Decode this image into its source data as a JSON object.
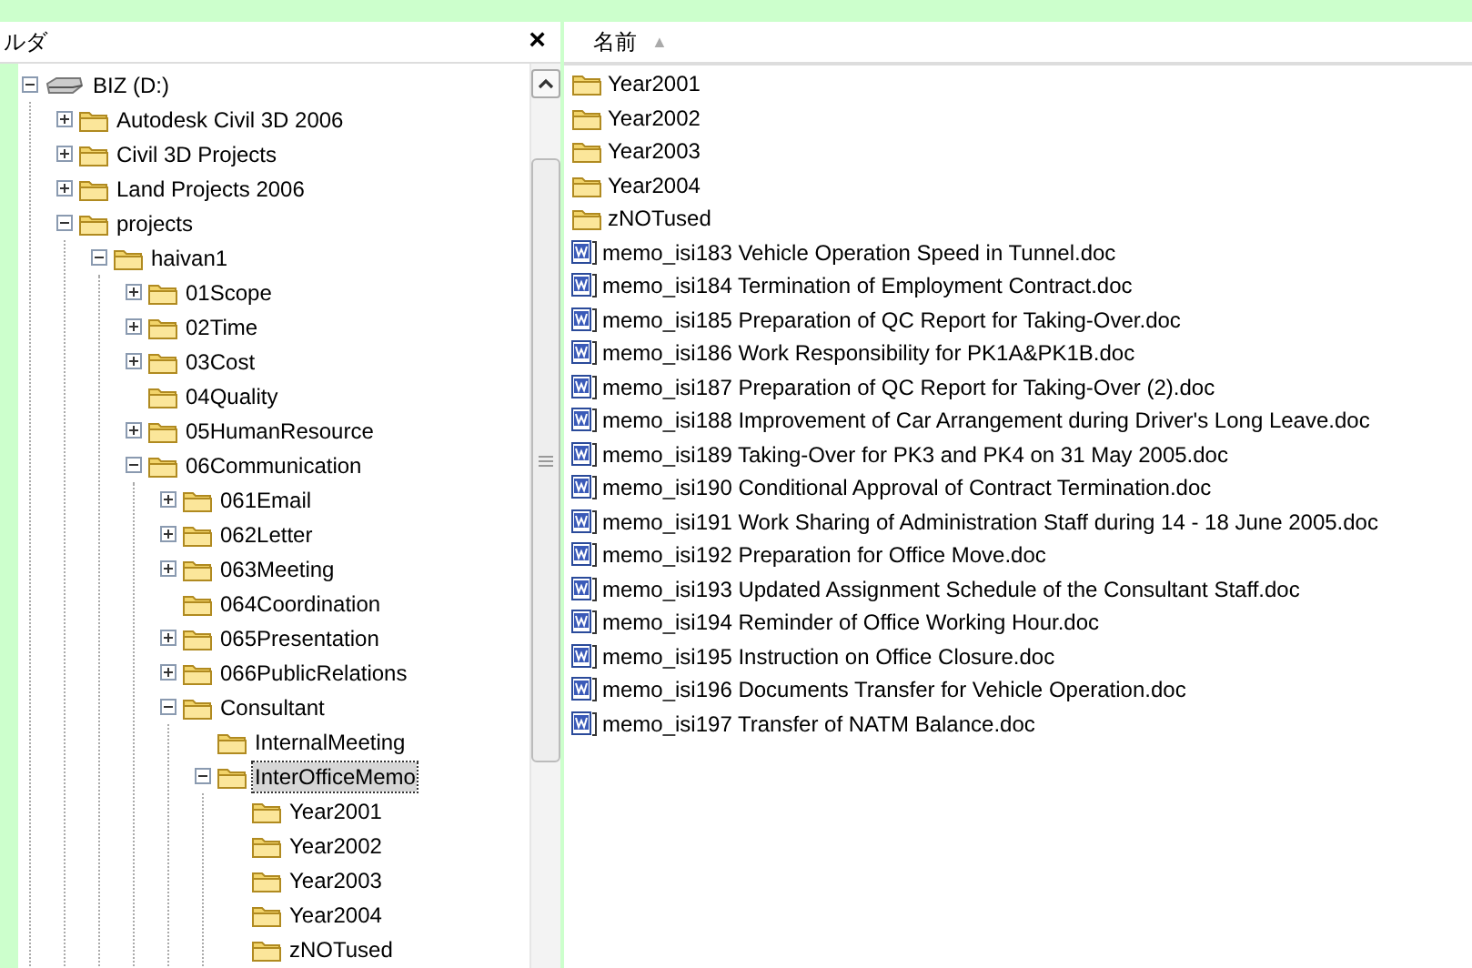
{
  "folder_pane": {
    "title": "ルダ",
    "close": "×",
    "tree": [
      {
        "label": "BIZ (D:)",
        "kind": "drive",
        "expanded": true,
        "selected": false,
        "children": [
          {
            "label": "Autodesk Civil 3D 2006",
            "kind": "folder",
            "expanded": false,
            "selected": false
          },
          {
            "label": "Civil 3D Projects",
            "kind": "folder",
            "expanded": false,
            "selected": false
          },
          {
            "label": "Land Projects 2006",
            "kind": "folder",
            "expanded": false,
            "selected": false
          },
          {
            "label": "projects",
            "kind": "folder",
            "expanded": true,
            "selected": false,
            "children": [
              {
                "label": "haivan1",
                "kind": "folder",
                "expanded": true,
                "selected": false,
                "children": [
                  {
                    "label": "01Scope",
                    "kind": "folder",
                    "expanded": false,
                    "selected": false
                  },
                  {
                    "label": "02Time",
                    "kind": "folder",
                    "expanded": false,
                    "selected": false
                  },
                  {
                    "label": "03Cost",
                    "kind": "folder",
                    "expanded": false,
                    "selected": false
                  },
                  {
                    "label": "04Quality",
                    "kind": "folder",
                    "selected": false
                  },
                  {
                    "label": "05HumanResource",
                    "kind": "folder",
                    "expanded": false,
                    "selected": false
                  },
                  {
                    "label": "06Communication",
                    "kind": "folder",
                    "expanded": true,
                    "selected": false,
                    "children": [
                      {
                        "label": "061Email",
                        "kind": "folder",
                        "expanded": false,
                        "selected": false
                      },
                      {
                        "label": "062Letter",
                        "kind": "folder",
                        "expanded": false,
                        "selected": false
                      },
                      {
                        "label": "063Meeting",
                        "kind": "folder",
                        "expanded": false,
                        "selected": false
                      },
                      {
                        "label": "064Coordination",
                        "kind": "folder",
                        "selected": false
                      },
                      {
                        "label": "065Presentation",
                        "kind": "folder",
                        "expanded": false,
                        "selected": false
                      },
                      {
                        "label": "066PublicRelations",
                        "kind": "folder",
                        "expanded": false,
                        "selected": false
                      },
                      {
                        "label": "Consultant",
                        "kind": "folder",
                        "expanded": true,
                        "selected": false,
                        "children": [
                          {
                            "label": "InternalMeeting",
                            "kind": "folder",
                            "selected": false
                          },
                          {
                            "label": "InterOfficeMemo",
                            "kind": "folder",
                            "expanded": true,
                            "selected": true,
                            "children": [
                              {
                                "label": "Year2001",
                                "kind": "folder",
                                "selected": false
                              },
                              {
                                "label": "Year2002",
                                "kind": "folder",
                                "selected": false
                              },
                              {
                                "label": "Year2003",
                                "kind": "folder",
                                "selected": false
                              },
                              {
                                "label": "Year2004",
                                "kind": "folder",
                                "selected": false
                              },
                              {
                                "label": "zNOTused",
                                "kind": "folder",
                                "selected": false
                              }
                            ]
                          }
                        ]
                      }
                    ]
                  }
                ]
              }
            ]
          }
        ]
      }
    ]
  },
  "file_pane": {
    "column": "名前",
    "sort": "▲",
    "files": [
      {
        "name": "Year2001",
        "kind": "folder"
      },
      {
        "name": "Year2002",
        "kind": "folder"
      },
      {
        "name": "Year2003",
        "kind": "folder"
      },
      {
        "name": "Year2004",
        "kind": "folder"
      },
      {
        "name": "zNOTused",
        "kind": "folder"
      },
      {
        "name": "memo_isi183 Vehicle Operation Speed in Tunnel.doc",
        "kind": "doc"
      },
      {
        "name": "memo_isi184 Termination of Employment Contract.doc",
        "kind": "doc"
      },
      {
        "name": "memo_isi185 Preparation of QC Report for Taking-Over.doc",
        "kind": "doc"
      },
      {
        "name": "memo_isi186 Work Responsibility for PK1A&PK1B.doc",
        "kind": "doc"
      },
      {
        "name": "memo_isi187 Preparation of QC Report for Taking-Over (2).doc",
        "kind": "doc"
      },
      {
        "name": "memo_isi188 Improvement of Car Arrangement during Driver's Long Leave.doc",
        "kind": "doc"
      },
      {
        "name": "memo_isi189 Taking-Over for PK3 and PK4 on 31 May 2005.doc",
        "kind": "doc"
      },
      {
        "name": "memo_isi190 Conditional Approval of Contract Termination.doc",
        "kind": "doc"
      },
      {
        "name": "memo_isi191 Work Sharing of Administration Staff during 14 - 18 June 2005.doc",
        "kind": "doc"
      },
      {
        "name": "memo_isi192 Preparation for Office Move.doc",
        "kind": "doc"
      },
      {
        "name": "memo_isi193 Updated Assignment Schedule of the Consultant Staff.doc",
        "kind": "doc"
      },
      {
        "name": "memo_isi194 Reminder of Office Working Hour.doc",
        "kind": "doc"
      },
      {
        "name": "memo_isi195 Instruction on Office Closure.doc",
        "kind": "doc"
      },
      {
        "name": "memo_isi196 Documents Transfer for Vehicle Operation.doc",
        "kind": "doc"
      },
      {
        "name": "memo_isi197 Transfer of NATM Balance.doc",
        "kind": "doc"
      }
    ]
  }
}
